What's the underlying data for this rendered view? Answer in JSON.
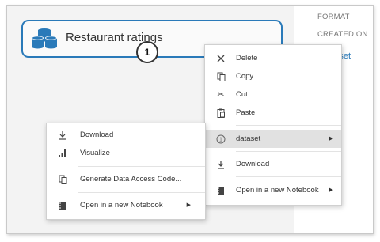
{
  "properties_panel": {
    "format_label": "FORMAT",
    "created_on_label": "CREATED ON",
    "dataset_link": "dataset"
  },
  "module": {
    "title": "Restaurant ratings",
    "icon": "database-icon",
    "output_port_number": "1"
  },
  "context_menu": {
    "items": [
      {
        "label": "Delete",
        "icon": "close-icon"
      },
      {
        "label": "Copy",
        "icon": "copy-icon"
      },
      {
        "label": "Cut",
        "icon": "scissors-icon"
      },
      {
        "label": "Paste",
        "icon": "paste-icon"
      },
      {
        "label": "dataset",
        "icon": "port-icon",
        "port_number": "1",
        "submenu": true
      },
      {
        "label": "Download",
        "icon": "download-icon"
      },
      {
        "label": "Open in a new Notebook",
        "icon": "notebook-icon",
        "submenu": true
      }
    ]
  },
  "dataset_submenu": {
    "items": [
      {
        "label": "Download",
        "icon": "download-icon"
      },
      {
        "label": "Visualize",
        "icon": "bar-chart-icon"
      },
      {
        "label": "Generate Data Access Code...",
        "icon": "copy-icon"
      },
      {
        "label": "Open in a new Notebook",
        "icon": "notebook-icon",
        "submenu": true
      }
    ]
  },
  "colors": {
    "accent": "#2a7ab9",
    "highlight": "#e1e1e1",
    "canvas": "#f3f3f3"
  }
}
